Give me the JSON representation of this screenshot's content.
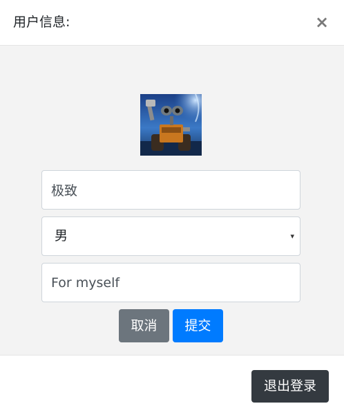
{
  "dialog": {
    "title": "用户信息:",
    "close_label": "×"
  },
  "form": {
    "name_value": "极致",
    "gender_value": "男",
    "gender_caret": "▾",
    "note_value": "For myself",
    "cancel_label": "取消",
    "submit_label": "提交"
  },
  "footer": {
    "logout_label": "退出登录"
  },
  "colors": {
    "cancel": "#6c757d",
    "submit": "#007bff",
    "logout": "#343a40",
    "body_bg": "#f3f3f3"
  }
}
